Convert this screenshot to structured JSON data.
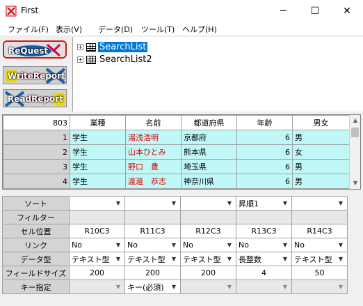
{
  "window": {
    "title": "First"
  },
  "window_controls": {
    "minimize": "─",
    "maximize": "☐",
    "close": "✕"
  },
  "menu": [
    "ファイル(F)",
    "表示(V)",
    "データ(D)",
    "ツール(T)",
    "ヘルプ(H)"
  ],
  "toolbar": {
    "buttons": [
      {
        "label": "ReQuest",
        "bg": "#1a5fb0"
      },
      {
        "label": "WriteReport",
        "bg": "#e8d800"
      },
      {
        "label": "ReadReport",
        "bg": "#1a5fb0"
      }
    ]
  },
  "tree": {
    "items": [
      {
        "label": "SearchList",
        "selected": true
      },
      {
        "label": "SearchList2",
        "selected": false
      }
    ]
  },
  "grid": {
    "corner": "803",
    "headers": [
      "業種",
      "名前",
      "都道府県",
      "年齢",
      "男女"
    ],
    "rows": [
      {
        "num": "1",
        "cells": [
          "学生",
          "湯浅浩明",
          "京都府",
          "6",
          "男"
        ]
      },
      {
        "num": "2",
        "cells": [
          "学生",
          "山本ひとみ",
          "熊本県",
          "6",
          "女"
        ]
      },
      {
        "num": "3",
        "cells": [
          "学生",
          "野口　豊",
          "埼玉県",
          "6",
          "男"
        ]
      },
      {
        "num": "4",
        "cells": [
          "学生",
          "渡邊　恭志",
          "神奈川県",
          "6",
          "男"
        ]
      }
    ]
  },
  "props": {
    "labels": [
      "ソート",
      "フィルター",
      "セル位置",
      "リンク",
      "データ型",
      "フィールドサイズ",
      "キー指定"
    ],
    "sort": [
      "",
      "",
      "",
      "昇順1",
      ""
    ],
    "cell_pos": [
      "R10C3",
      "R11C3",
      "R12C3",
      "R13C3",
      "R14C3"
    ],
    "link": [
      "No",
      "No",
      "No",
      "No",
      "No"
    ],
    "dtype": [
      "テキスト型",
      "テキスト型",
      "テキスト型",
      "長整数",
      "テキスト型"
    ],
    "field_size": [
      "200",
      "200",
      "200",
      "4",
      "50"
    ],
    "key": [
      "",
      "キー(必須)",
      "",
      "",
      ""
    ]
  },
  "colors": {
    "cell_bg": "#c0f8f8",
    "name_text": "#e00000",
    "selection": "#0078d7",
    "highlight_border": "#d21a1a"
  }
}
